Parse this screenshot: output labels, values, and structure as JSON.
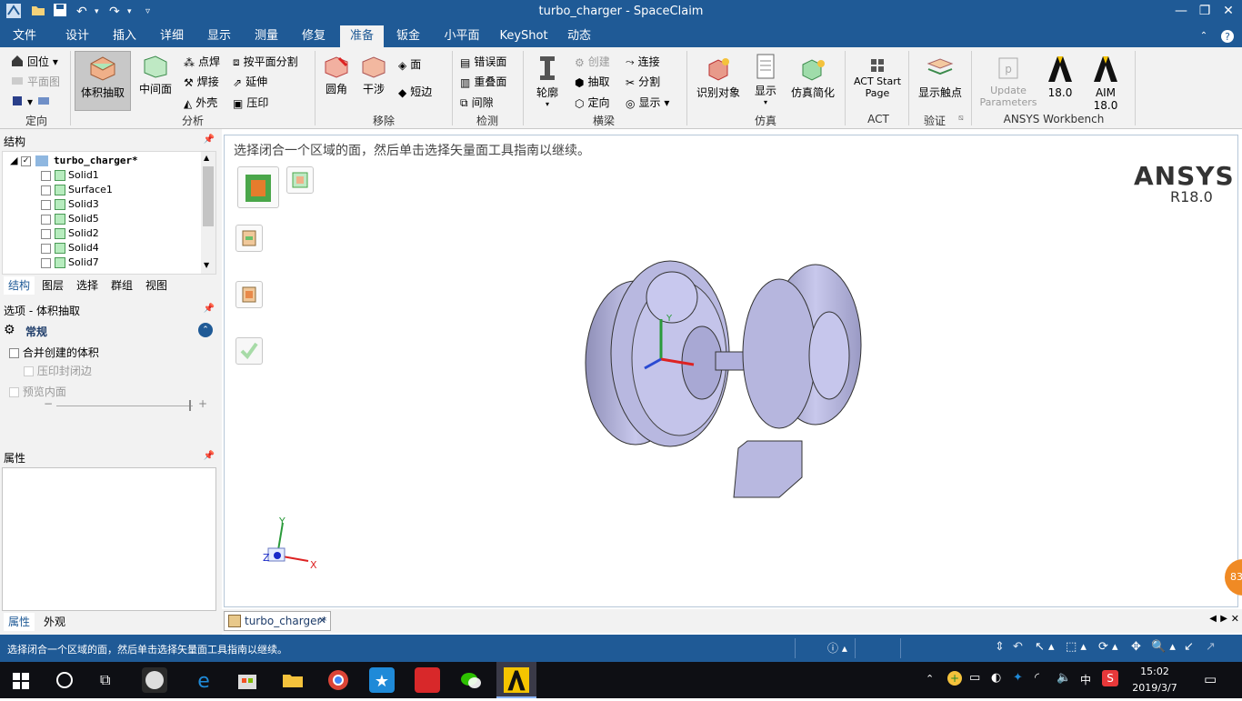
{
  "window": {
    "title": "turbo_charger - SpaceClaim"
  },
  "menu": {
    "tabs": [
      "文件",
      "设计",
      "插入",
      "详细",
      "显示",
      "测量",
      "修复",
      "准备",
      "钣金",
      "小平面",
      "KeyShot",
      "动态"
    ],
    "active_index": 7
  },
  "ribbon": {
    "orient": {
      "home": "回位",
      "plane_view": "平面图",
      "group": "定向"
    },
    "analysis": {
      "volume_extract": "体积抽取",
      "midsurface": "中间面",
      "spot_weld": "点焊",
      "weld": "焊接",
      "shell": "外壳",
      "split_by_plane": "按平面分割",
      "extend": "延伸",
      "imprint": "压印",
      "group": "分析"
    },
    "remove": {
      "round": "圆角",
      "interference": "干涉",
      "face": "面",
      "short_edge": "短边",
      "group": "移除"
    },
    "detect": {
      "misaligned": "错误面",
      "overlap": "重叠面",
      "gap": "间隙",
      "group": "检测"
    },
    "beam": {
      "profile": "轮廓",
      "create": "创建",
      "extract": "抽取",
      "orient": "定向",
      "connect": "连接",
      "split": "分割",
      "display": "显示",
      "group": "横梁"
    },
    "sim": {
      "identify": "识别对象",
      "display": "显示",
      "simplify": "仿真简化",
      "group": "仿真"
    },
    "act": {
      "start_page": "ACT Start Page",
      "group": "ACT"
    },
    "verify": {
      "show_contact": "显示触点",
      "group": "验证"
    },
    "workbench": {
      "update": "Update Parameters",
      "v18": "18.0",
      "aim": "AIM 18.0",
      "group": "ANSYS Workbench"
    }
  },
  "structure": {
    "title": "结构",
    "root": "turbo_charger*",
    "items": [
      "Solid1",
      "Surface1",
      "Solid3",
      "Solid5",
      "Solid2",
      "Solid4",
      "Solid7"
    ],
    "tabs": [
      "结构",
      "图层",
      "选择",
      "群组",
      "视图"
    ]
  },
  "options": {
    "title": "选项 - 体积抽取",
    "section": "常规",
    "merge": "合并创建的体积",
    "imprint_closed": "压印封闭边",
    "preview": "预览内面"
  },
  "properties": {
    "title": "属性",
    "tabs": [
      "属性",
      "外观"
    ]
  },
  "viewport": {
    "hint": "选择闭合一个区域的面，然后单击选择矢量面工具指南以继续。",
    "brand": "ANSYS",
    "version": "R18.0",
    "axis_x": "X",
    "axis_y": "Y",
    "axis_z": "Z",
    "badge": "83"
  },
  "doc_tab": "turbo_charger*",
  "status": {
    "message": "选择闭合一个区域的面，然后单击选择矢量面工具指南以继续。"
  },
  "taskbar": {
    "time": "15:02",
    "date": "2019/3/7",
    "ime": "中"
  }
}
